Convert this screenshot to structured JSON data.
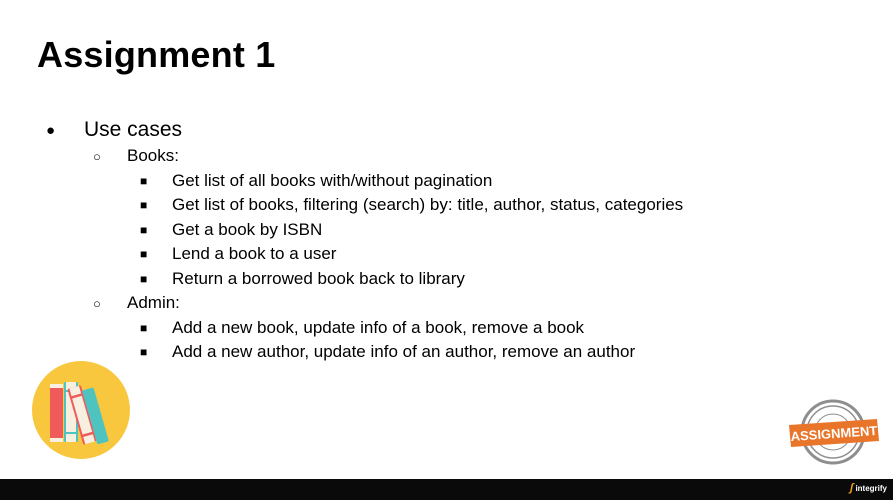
{
  "slide": {
    "title": "Assignment 1",
    "section": {
      "bullet_icon": "filled-circle",
      "label": "Use cases"
    },
    "groups": [
      {
        "label": "Books:",
        "items": [
          "Get list of all books with/without pagination",
          "Get list of books, filtering (search) by: title, author, status, categories",
          "Get a book by ISBN",
          "Lend a book to a user",
          "Return a borrowed book back to library"
        ]
      },
      {
        "label": "Admin:",
        "items": [
          "Add a new book, update info of a book, remove a book",
          "Add a new author, update info of an author, remove an author"
        ]
      }
    ],
    "stamp_text": "ASSIGNMENT",
    "footer_brand": "integrify",
    "colors": {
      "logo_circle": "#f9c73e",
      "book_red": "#ef5a5a",
      "book_teal": "#4ec3c0",
      "stamp_orange": "#e8752a",
      "footer_bar": "#0a0a0a"
    }
  }
}
